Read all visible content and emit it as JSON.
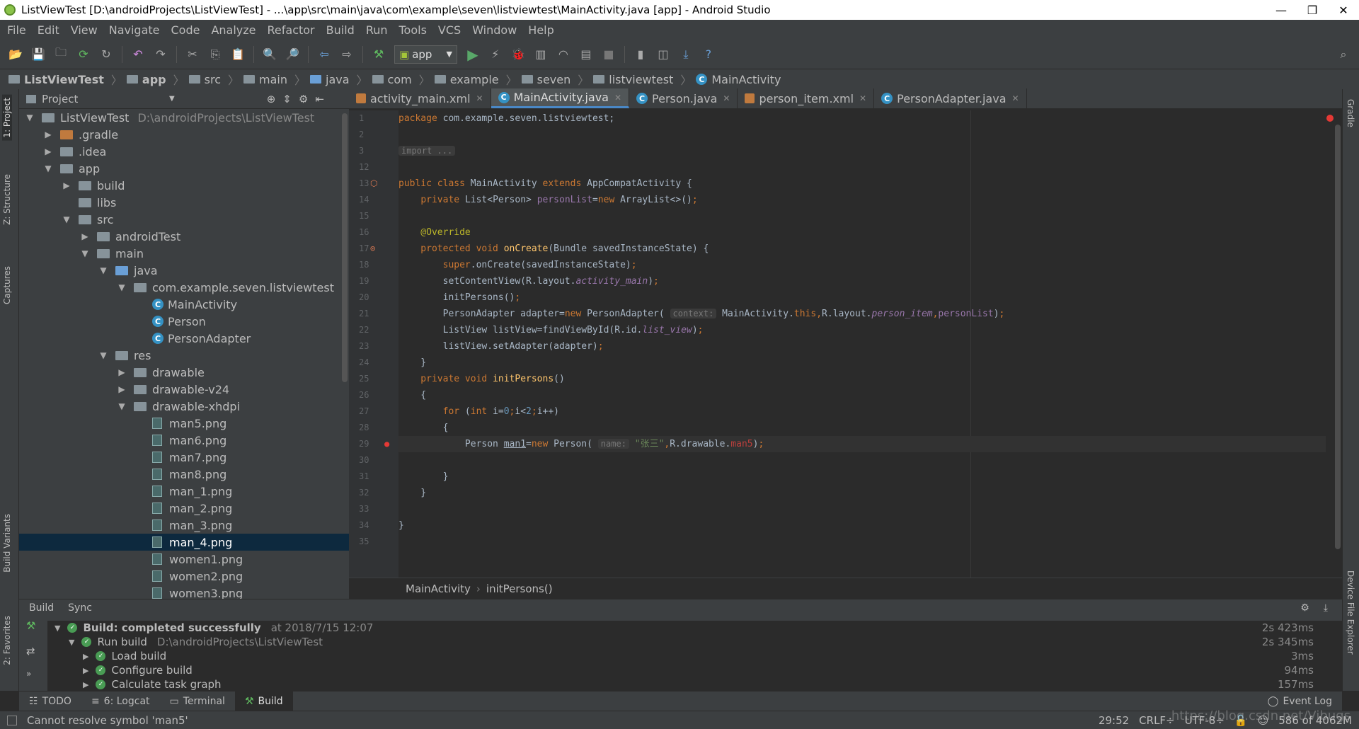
{
  "window": {
    "title": "ListViewTest [D:\\androidProjects\\ListViewTest] - ...\\app\\src\\main\\java\\com\\example\\seven\\listviewtest\\MainActivity.java [app] - Android Studio"
  },
  "menu": [
    "File",
    "Edit",
    "View",
    "Navigate",
    "Code",
    "Analyze",
    "Refactor",
    "Build",
    "Run",
    "Tools",
    "VCS",
    "Window",
    "Help"
  ],
  "toolbar": {
    "run_config": "app"
  },
  "breadcrumb": [
    "ListViewTest",
    "app",
    "src",
    "main",
    "java",
    "com",
    "example",
    "seven",
    "listviewtest",
    "MainActivity"
  ],
  "project": {
    "header": "Project",
    "tree": [
      {
        "label": "ListViewTest",
        "extra": "D:\\androidProjects\\ListViewTest",
        "indent": 0,
        "arrow": "▼",
        "icon": "folder"
      },
      {
        "label": ".gradle",
        "indent": 1,
        "arrow": "▶",
        "icon": "folder-orange"
      },
      {
        "label": ".idea",
        "indent": 1,
        "arrow": "▶",
        "icon": "folder"
      },
      {
        "label": "app",
        "indent": 1,
        "arrow": "▼",
        "icon": "folder"
      },
      {
        "label": "build",
        "indent": 2,
        "arrow": "▶",
        "icon": "folder"
      },
      {
        "label": "libs",
        "indent": 2,
        "arrow": "",
        "icon": "folder"
      },
      {
        "label": "src",
        "indent": 2,
        "arrow": "▼",
        "icon": "folder"
      },
      {
        "label": "androidTest",
        "indent": 3,
        "arrow": "▶",
        "icon": "folder"
      },
      {
        "label": "main",
        "indent": 3,
        "arrow": "▼",
        "icon": "folder"
      },
      {
        "label": "java",
        "indent": 4,
        "arrow": "▼",
        "icon": "folder-blue"
      },
      {
        "label": "com.example.seven.listviewtest",
        "indent": 5,
        "arrow": "▼",
        "icon": "folder"
      },
      {
        "label": "MainActivity",
        "indent": 6,
        "arrow": "",
        "icon": "class"
      },
      {
        "label": "Person",
        "indent": 6,
        "arrow": "",
        "icon": "class"
      },
      {
        "label": "PersonAdapter",
        "indent": 6,
        "arrow": "",
        "icon": "class"
      },
      {
        "label": "res",
        "indent": 4,
        "arrow": "▼",
        "icon": "folder"
      },
      {
        "label": "drawable",
        "indent": 5,
        "arrow": "▶",
        "icon": "folder"
      },
      {
        "label": "drawable-v24",
        "indent": 5,
        "arrow": "▶",
        "icon": "folder"
      },
      {
        "label": "drawable-xhdpi",
        "indent": 5,
        "arrow": "▼",
        "icon": "folder"
      },
      {
        "label": "man5.png",
        "indent": 6,
        "arrow": "",
        "icon": "image"
      },
      {
        "label": "man6.png",
        "indent": 6,
        "arrow": "",
        "icon": "image"
      },
      {
        "label": "man7.png",
        "indent": 6,
        "arrow": "",
        "icon": "image"
      },
      {
        "label": "man8.png",
        "indent": 6,
        "arrow": "",
        "icon": "image"
      },
      {
        "label": "man_1.png",
        "indent": 6,
        "arrow": "",
        "icon": "image"
      },
      {
        "label": "man_2.png",
        "indent": 6,
        "arrow": "",
        "icon": "image"
      },
      {
        "label": "man_3.png",
        "indent": 6,
        "arrow": "",
        "icon": "image"
      },
      {
        "label": "man_4.png",
        "indent": 6,
        "arrow": "",
        "icon": "image",
        "selected": true
      },
      {
        "label": "women1.png",
        "indent": 6,
        "arrow": "",
        "icon": "image"
      },
      {
        "label": "women2.png",
        "indent": 6,
        "arrow": "",
        "icon": "image"
      },
      {
        "label": "women3.png",
        "indent": 6,
        "arrow": "",
        "icon": "image"
      }
    ]
  },
  "tabs": [
    {
      "label": "activity_main.xml",
      "icon": "xml"
    },
    {
      "label": "MainActivity.java",
      "icon": "class",
      "active": true
    },
    {
      "label": "Person.java",
      "icon": "class"
    },
    {
      "label": "person_item.xml",
      "icon": "xml"
    },
    {
      "label": "PersonAdapter.java",
      "icon": "class"
    }
  ],
  "code": {
    "line_numbers": [
      "1",
      "2",
      "3",
      "12",
      "13",
      "14",
      "15",
      "16",
      "17",
      "18",
      "19",
      "20",
      "21",
      "22",
      "23",
      "24",
      "25",
      "26",
      "27",
      "28",
      "29",
      "30",
      "31",
      "32",
      "33",
      "34",
      "35"
    ]
  },
  "editor_breadcrumb": [
    "MainActivity",
    "initPersons()"
  ],
  "build": {
    "tabs": [
      "Build",
      "Sync"
    ],
    "rows": [
      {
        "label": "Build: completed successfully",
        "extra": "at 2018/7/15 12:07",
        "time": "2s 423ms",
        "indent": 0,
        "arrow": "▼",
        "bold": true
      },
      {
        "label": "Run build",
        "extra": "D:\\androidProjects\\ListViewTest",
        "time": "2s 345ms",
        "indent": 1,
        "arrow": "▼"
      },
      {
        "label": "Load build",
        "extra": "",
        "time": "3ms",
        "indent": 2,
        "arrow": "▶"
      },
      {
        "label": "Configure build",
        "extra": "",
        "time": "94ms",
        "indent": 2,
        "arrow": "▶"
      },
      {
        "label": "Calculate task graph",
        "extra": "",
        "time": "157ms",
        "indent": 2,
        "arrow": "▶"
      }
    ]
  },
  "bottom_tabs": [
    {
      "label": "TODO"
    },
    {
      "label": "6: Logcat"
    },
    {
      "label": "Terminal"
    },
    {
      "label": "Build",
      "active": true
    }
  ],
  "event_log": "Event Log",
  "status": {
    "message": "Cannot resolve symbol 'man5'",
    "position": "29:52",
    "line_sep": "CRLF÷",
    "encoding": "UTF-8÷",
    "memory": "586 of 4062M",
    "watermark": "https://blog.csdn.net/Vibugs"
  },
  "side": {
    "left": [
      "1: Project",
      "Z: Structure",
      "Captures",
      "Build Variants",
      "2: Favorites"
    ],
    "right": [
      "Gradle",
      "Device File Explorer"
    ]
  }
}
